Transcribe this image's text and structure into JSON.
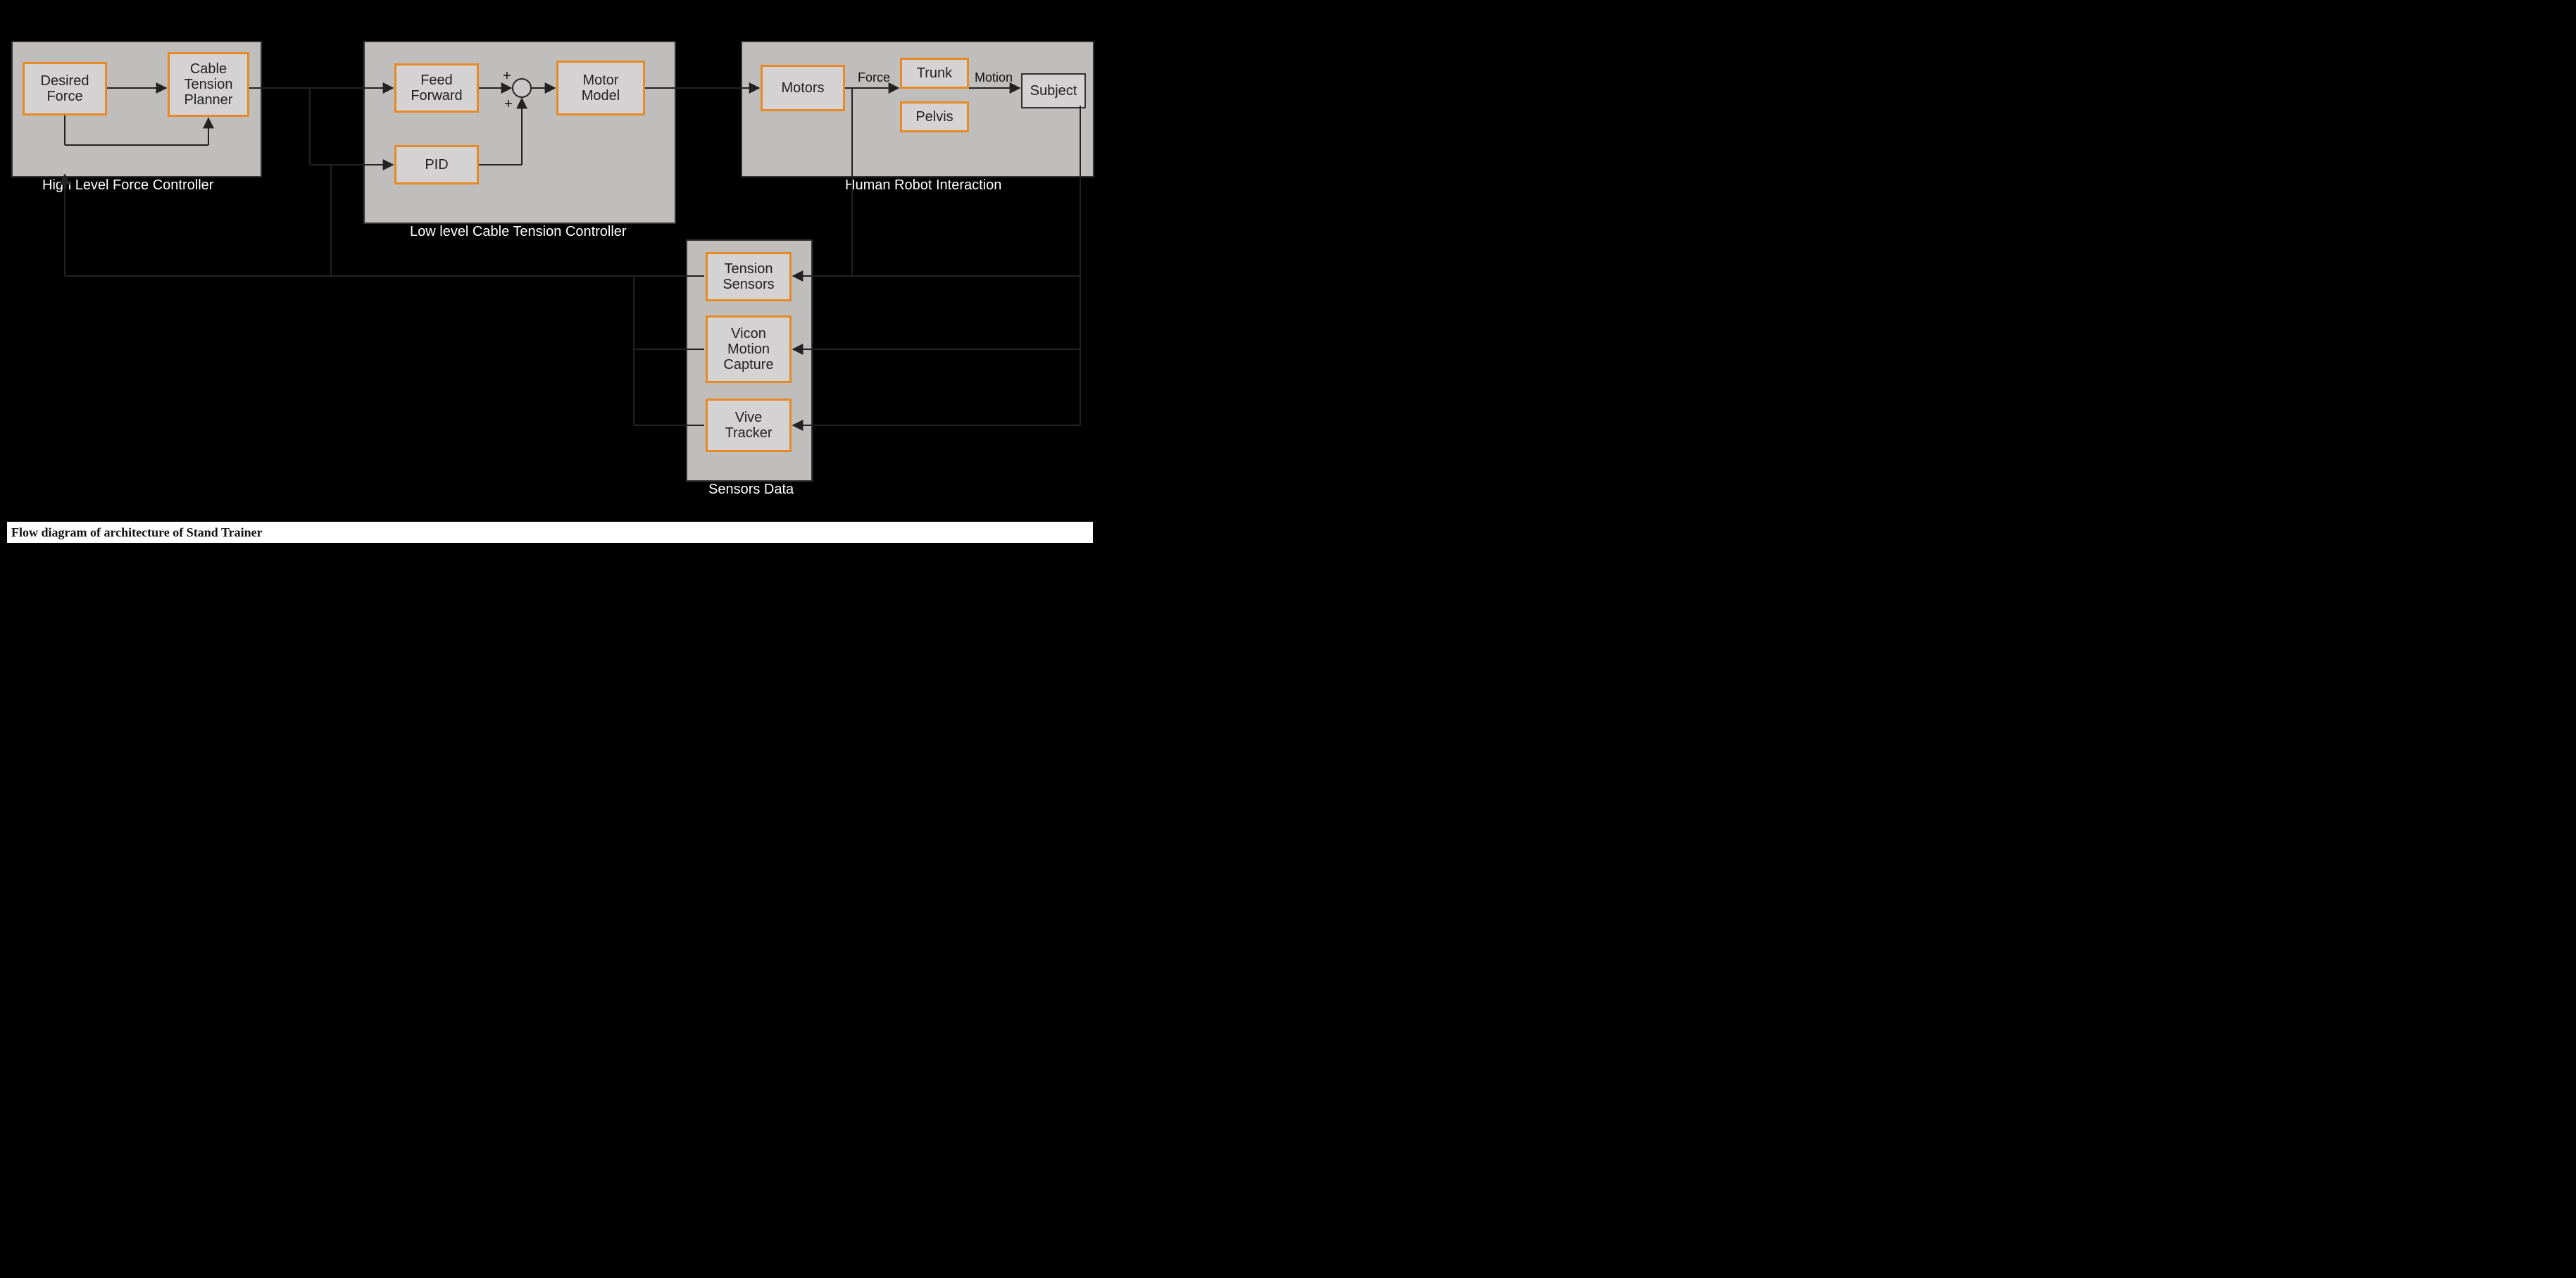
{
  "groups": {
    "high_level": "High Level Force Controller",
    "low_level": "Low level Cable Tension Controller",
    "hri": "Human Robot Interaction",
    "sensors": "Sensors Data"
  },
  "blocks": {
    "desired_force": "Desired Force",
    "cable_tension_planner": "Cable Tension Planner",
    "feed_forward": "Feed Forward",
    "pid": "PID",
    "motor_model": "Motor Model",
    "motors": "Motors",
    "trunk": "Trunk",
    "pelvis": "Pelvis",
    "subject": "Subject",
    "tension_sensors": "Tension Sensors",
    "vicon": "Vicon Motion Capture",
    "vive": "Vive Tracker"
  },
  "edge_labels": {
    "force": "Force",
    "motion": "Motion"
  },
  "summing": {
    "top_plus": "+",
    "bottom_plus": "+"
  },
  "caption": "Flow diagram of architecture of Stand Trainer"
}
